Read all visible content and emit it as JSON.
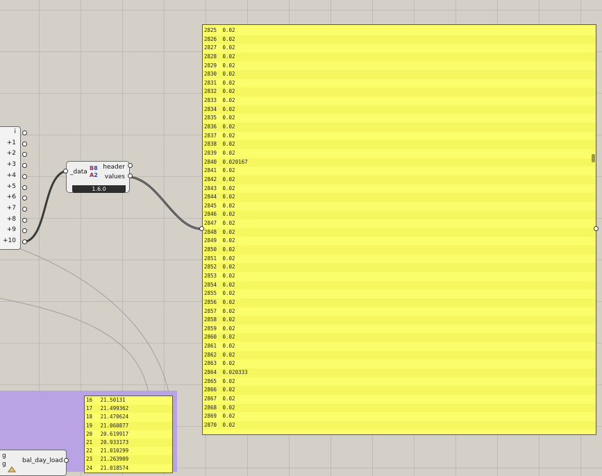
{
  "left_component": {
    "outputs": [
      "i",
      "+1",
      "+2",
      "+3",
      "+4",
      "+5",
      "+6",
      "+7",
      "+8",
      "+9",
      "+10"
    ]
  },
  "convert_component": {
    "input": "_data",
    "outputs": [
      "header",
      "values"
    ],
    "version": "1.6.0",
    "icon": "bits-convert-icon"
  },
  "main_panel": {
    "rows": [
      {
        "i": "2825",
        "v": "0.02"
      },
      {
        "i": "2826",
        "v": "0.02"
      },
      {
        "i": "2827",
        "v": "0.02"
      },
      {
        "i": "2828",
        "v": "0.02"
      },
      {
        "i": "2829",
        "v": "0.02"
      },
      {
        "i": "2830",
        "v": "0.02"
      },
      {
        "i": "2831",
        "v": "0.02"
      },
      {
        "i": "2832",
        "v": "0.02"
      },
      {
        "i": "2833",
        "v": "0.02"
      },
      {
        "i": "2834",
        "v": "0.02"
      },
      {
        "i": "2835",
        "v": "0.02"
      },
      {
        "i": "2836",
        "v": "0.02"
      },
      {
        "i": "2837",
        "v": "0.02"
      },
      {
        "i": "2838",
        "v": "0.02"
      },
      {
        "i": "2839",
        "v": "0.02"
      },
      {
        "i": "2840",
        "v": "0.020167"
      },
      {
        "i": "2841",
        "v": "0.02"
      },
      {
        "i": "2842",
        "v": "0.02"
      },
      {
        "i": "2843",
        "v": "0.02"
      },
      {
        "i": "2844",
        "v": "0.02"
      },
      {
        "i": "2845",
        "v": "0.02"
      },
      {
        "i": "2846",
        "v": "0.02"
      },
      {
        "i": "2847",
        "v": "0.02"
      },
      {
        "i": "2848",
        "v": "0.02"
      },
      {
        "i": "2849",
        "v": "0.02"
      },
      {
        "i": "2850",
        "v": "0.02"
      },
      {
        "i": "2851",
        "v": "0.02"
      },
      {
        "i": "2852",
        "v": "0.02"
      },
      {
        "i": "2853",
        "v": "0.02"
      },
      {
        "i": "2854",
        "v": "0.02"
      },
      {
        "i": "2855",
        "v": "0.02"
      },
      {
        "i": "2856",
        "v": "0.02"
      },
      {
        "i": "2857",
        "v": "0.02"
      },
      {
        "i": "2858",
        "v": "0.02"
      },
      {
        "i": "2859",
        "v": "0.02"
      },
      {
        "i": "2860",
        "v": "0.02"
      },
      {
        "i": "2861",
        "v": "0.02"
      },
      {
        "i": "2862",
        "v": "0.02"
      },
      {
        "i": "2863",
        "v": "0.02"
      },
      {
        "i": "2864",
        "v": "0.020333"
      },
      {
        "i": "2865",
        "v": "0.02"
      },
      {
        "i": "2866",
        "v": "0.02"
      },
      {
        "i": "2867",
        "v": "0.02"
      },
      {
        "i": "2868",
        "v": "0.02"
      },
      {
        "i": "2869",
        "v": "0.02"
      },
      {
        "i": "2870",
        "v": "0.02"
      }
    ]
  },
  "small_panel": {
    "rows": [
      {
        "i": "16",
        "v": "21.50131"
      },
      {
        "i": "17",
        "v": "21.499362"
      },
      {
        "i": "18",
        "v": "21.470624"
      },
      {
        "i": "19",
        "v": "21.060877"
      },
      {
        "i": "20",
        "v": "20.619917"
      },
      {
        "i": "21",
        "v": "20.933173"
      },
      {
        "i": "22",
        "v": "21.010299"
      },
      {
        "i": "23",
        "v": "21.263909"
      },
      {
        "i": "24",
        "v": "21.018574"
      }
    ]
  },
  "bal_component": {
    "label": "bal_day_load",
    "inputs": [
      "g",
      "g"
    ],
    "icon": "ladybug-icon"
  }
}
